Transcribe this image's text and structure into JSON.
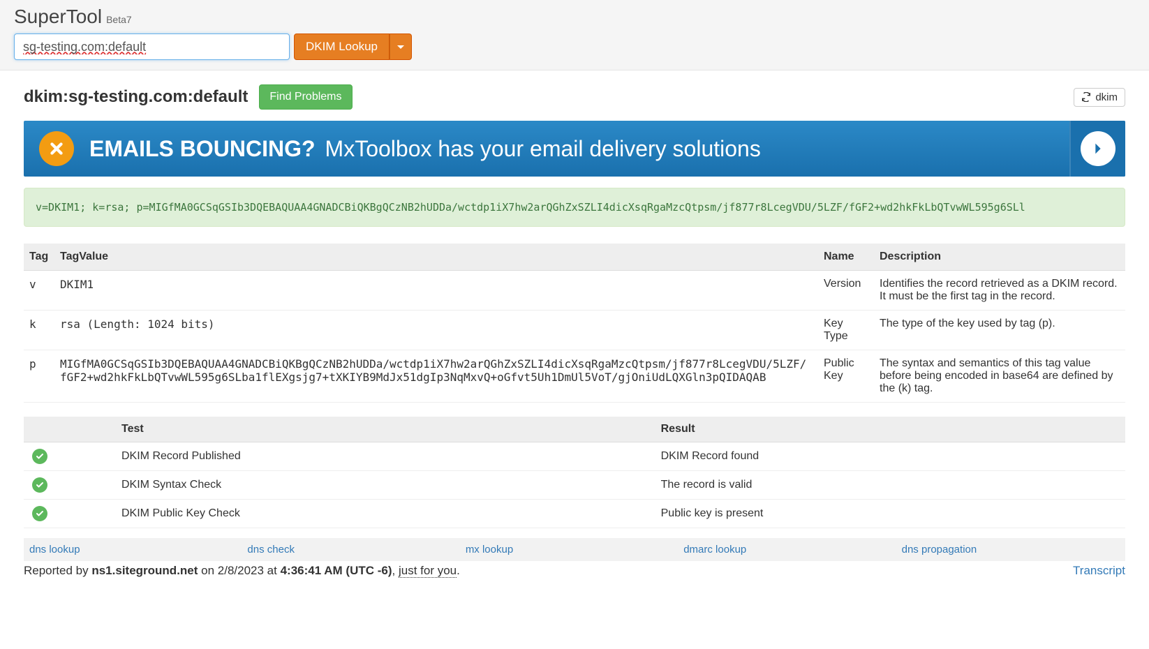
{
  "header": {
    "title": "SuperTool",
    "badge": "Beta7",
    "search_value": "sg-testing.com:default",
    "lookup_button": "DKIM Lookup"
  },
  "result": {
    "title": "dkim:sg-testing.com:default",
    "find_problems": "Find Problems",
    "refresh_label": "dkim"
  },
  "banner": {
    "bold": "EMAILS BOUNCING?",
    "light": "MxToolbox has your email delivery solutions"
  },
  "record": "v=DKIM1; k=rsa; p=MIGfMA0GCSqGSIb3DQEBAQUAA4GNADCBiQKBgQCzNB2hUDDa/wctdp1iX7hw2arQGhZxSZLI4dicXsqRgaMzcQtpsm/jf877r8LcegVDU/5LZF/fGF2+wd2hkFkLbQTvwWL595g6SLl",
  "tag_table": {
    "headers": {
      "tag": "Tag",
      "tagvalue": "TagValue",
      "name": "Name",
      "description": "Description"
    },
    "rows": [
      {
        "tag": "v",
        "tagvalue": "DKIM1",
        "name": "Version",
        "desc": "Identifies the record retrieved as a DKIM record. It must be the first tag in the record."
      },
      {
        "tag": "k",
        "tagvalue": "rsa (Length: 1024 bits)",
        "name": "Key Type",
        "desc": "The type of the key used by tag (p)."
      },
      {
        "tag": "p",
        "tagvalue": "MIGfMA0GCSqGSIb3DQEBAQUAA4GNADCBiQKBgQCzNB2hUDDa/wctdp1iX7hw2arQGhZxSZLI4dicXsqRgaMzcQtpsm/jf877r8LcegVDU/5LZF/fGF2+wd2hkFkLbQTvwWL595g6SLba1flEXgsjg7+tXKIYB9MdJx51dgIp3NqMxvQ+oGfvt5Uh1DmUl5VoT/gjOniUdLQXGln3pQIDAQAB",
        "name": "Public Key",
        "desc": "The syntax and semantics of this tag value before being encoded in base64 are defined by the (k) tag."
      }
    ]
  },
  "tests_table": {
    "headers": {
      "test": "Test",
      "result": "Result"
    },
    "rows": [
      {
        "test": "DKIM Record Published",
        "result": "DKIM Record found"
      },
      {
        "test": "DKIM Syntax Check",
        "result": "The record is valid"
      },
      {
        "test": "DKIM Public Key Check",
        "result": "Public key is present"
      }
    ]
  },
  "links": {
    "dns_lookup": "dns lookup",
    "dns_check": "dns check",
    "mx_lookup": "mx lookup",
    "dmarc_lookup": "dmarc lookup",
    "dns_propagation": "dns propagation"
  },
  "footer": {
    "prefix": "Reported by ",
    "server": "ns1.siteground.net",
    "on": " on 2/8/2023 at ",
    "time": "4:36:41 AM (UTC -6)",
    "sep": ", ",
    "just": "just for you",
    "period": ".",
    "transcript": "Transcript"
  }
}
